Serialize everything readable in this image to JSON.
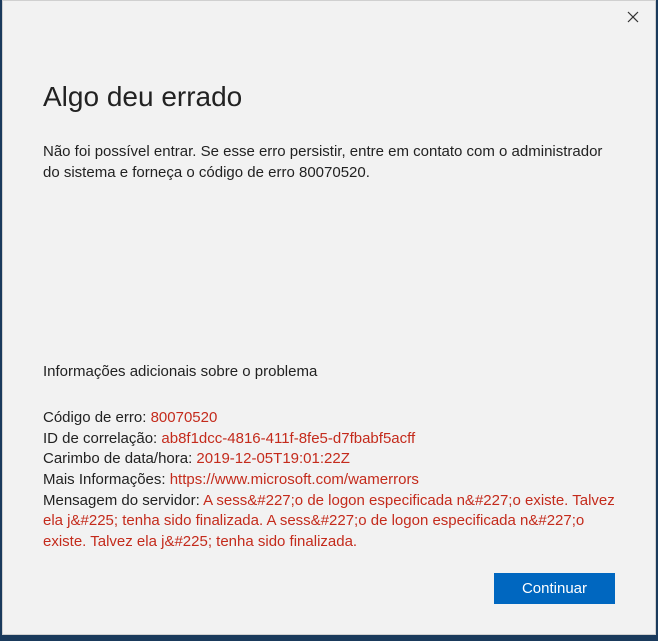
{
  "dialog": {
    "title": "Algo deu errado",
    "message": "Não foi possível entrar. Se esse erro persistir, entre em contato com o administrador do sistema e forneça o código de erro 80070520.",
    "subheading": "Informações adicionais sobre o problema",
    "details": {
      "error_code_label": "Código de erro: ",
      "error_code_value": "80070520",
      "correlation_label": "ID de correlação: ",
      "correlation_value": "ab8f1dcc-4816-411f-8fe5-d7fbabf5acff",
      "timestamp_label": "Carimbo de data/hora: ",
      "timestamp_value": "2019-12-05T19:01:22Z",
      "moreinfo_label": "Mais Informações: ",
      "moreinfo_value": "https://www.microsoft.com/wamerrors",
      "servermsg_label": "Mensagem do servidor: ",
      "servermsg_value": "A sess&#227;o de logon especificada n&#227;o existe. Talvez ela j&#225; tenha sido finalizada. A sess&#227;o de logon especificada n&#227;o existe. Talvez ela j&#225; tenha sido finalizada."
    },
    "continue_label": "Continuar"
  }
}
